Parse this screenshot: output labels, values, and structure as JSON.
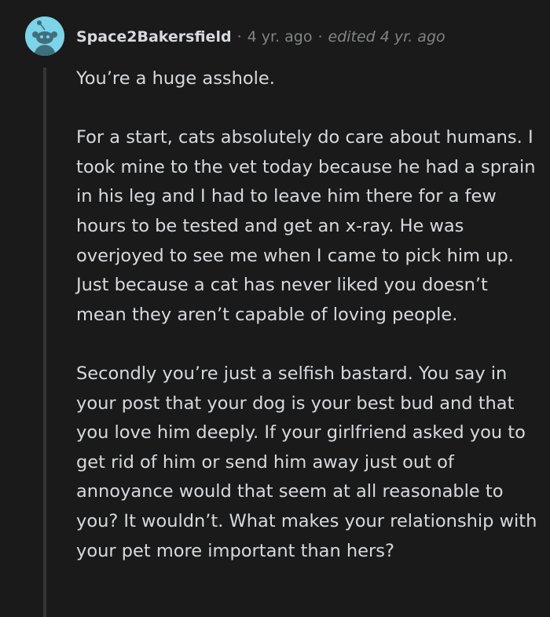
{
  "comment": {
    "author": "Space2Bakersfield",
    "separator": "·",
    "time": "4 yr. ago",
    "edited": "edited 4 yr. ago",
    "avatar_icon": "snoo-avatar-icon",
    "paragraphs": [
      "You’re a huge asshole.",
      "For a start, cats absolutely do care about humans. I took mine to the vet today because he had a sprain in his leg and I had to leave him there for a few hours to be tested and get an x-ray. He was overjoyed to see me when I came to pick him up. Just because a cat has never liked you doesn’t mean they aren’t capable of loving people.",
      "Secondly you’re just a selfish bastard. You say in your post that your dog is your best bud and that you love him deeply. If your girlfriend asked you to get rid of him or send him away just out of annoyance would that seem at all reasonable to you? It wouldn’t. What makes your relationship with your pet more important than hers?"
    ]
  },
  "colors": {
    "background": "#1a1a1b",
    "text": "#d7dadc",
    "meta": "#818384",
    "avatar_bg": "#7dd3e8",
    "thread_line": "#343536"
  }
}
